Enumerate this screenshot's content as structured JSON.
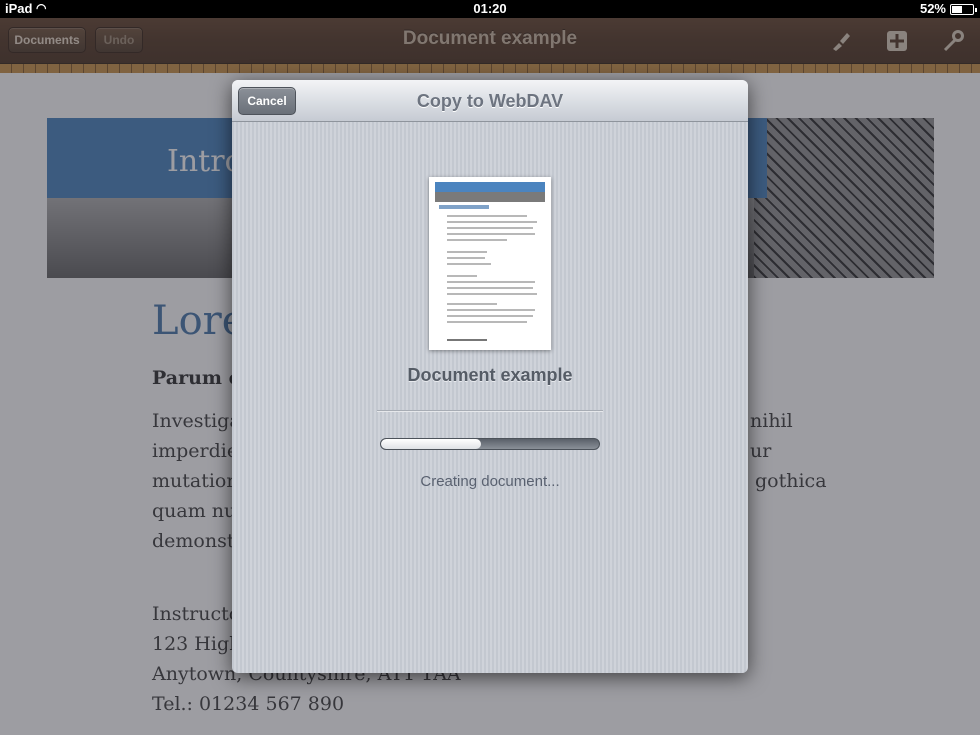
{
  "status_bar": {
    "carrier": "iPad",
    "time": "01:20",
    "battery_percent": "52%",
    "battery_level": 0.52
  },
  "toolbar": {
    "documents_label": "Documents",
    "undo_label": "Undo",
    "title": "Document example"
  },
  "document": {
    "banner_title": "Intro",
    "heading": "Lore",
    "subheading": "Parum c",
    "body_left": [
      "Investiga",
      "imperdie",
      "mutation",
      "quam nu",
      "demonstr"
    ],
    "body_right": [
      "nihil",
      "ur",
      "gothica"
    ],
    "address_left": [
      "Instructo",
      "123 High"
    ],
    "address_lines": [
      "Anytown, Countyshire, AT1 1AA",
      "Tel.: 01234 567 890"
    ]
  },
  "modal": {
    "title": "Copy to WebDAV",
    "cancel_label": "Cancel",
    "document_name": "Document example",
    "progress": 0.46,
    "status_text": "Creating document..."
  },
  "colors": {
    "toolbar": "#4a2d18",
    "accent_blue": "#3d7ab8",
    "modal_bg": "#c9cdd4"
  }
}
